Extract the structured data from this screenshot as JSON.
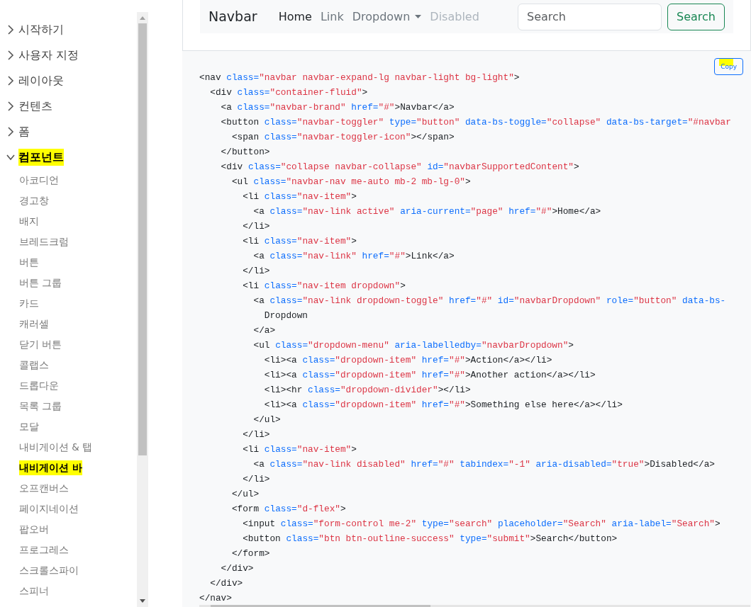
{
  "sidebar": {
    "sections": [
      {
        "label": "시작하기",
        "expanded": false,
        "highlighted": false
      },
      {
        "label": "사용자 지정",
        "expanded": false,
        "highlighted": false
      },
      {
        "label": "레이아웃",
        "expanded": false,
        "highlighted": false
      },
      {
        "label": "컨텐츠",
        "expanded": false,
        "highlighted": false
      },
      {
        "label": "폼",
        "expanded": false,
        "highlighted": false
      },
      {
        "label": "컴포넌트",
        "expanded": true,
        "highlighted": true,
        "children": [
          {
            "label": "아코디언",
            "selected": false,
            "highlighted": false
          },
          {
            "label": "경고창",
            "selected": false,
            "highlighted": false
          },
          {
            "label": "배지",
            "selected": false,
            "highlighted": false
          },
          {
            "label": "브레드크럼",
            "selected": false,
            "highlighted": false
          },
          {
            "label": "버튼",
            "selected": false,
            "highlighted": false
          },
          {
            "label": "버튼 그룹",
            "selected": false,
            "highlighted": false
          },
          {
            "label": "카드",
            "selected": false,
            "highlighted": false
          },
          {
            "label": "캐러셀",
            "selected": false,
            "highlighted": false
          },
          {
            "label": "닫기 버튼",
            "selected": false,
            "highlighted": false
          },
          {
            "label": "콜랩스",
            "selected": false,
            "highlighted": false
          },
          {
            "label": "드롭다운",
            "selected": false,
            "highlighted": false
          },
          {
            "label": "목록 그룹",
            "selected": false,
            "highlighted": false
          },
          {
            "label": "모달",
            "selected": false,
            "highlighted": false
          },
          {
            "label": "내비게이션 & 탭",
            "selected": false,
            "highlighted": false
          },
          {
            "label": "내비게이션 바",
            "selected": true,
            "highlighted": true
          },
          {
            "label": "오프캔버스",
            "selected": false,
            "highlighted": false
          },
          {
            "label": "페이지네이션",
            "selected": false,
            "highlighted": false
          },
          {
            "label": "팝오버",
            "selected": false,
            "highlighted": false
          },
          {
            "label": "프로그레스",
            "selected": false,
            "highlighted": false
          },
          {
            "label": "스크롤스파이",
            "selected": false,
            "highlighted": false
          },
          {
            "label": "스피너",
            "selected": false,
            "highlighted": false
          }
        ]
      }
    ]
  },
  "example": {
    "brand": "Navbar",
    "links": [
      {
        "label": "Home",
        "kind": "active"
      },
      {
        "label": "Link",
        "kind": "normal"
      },
      {
        "label": "Dropdown",
        "kind": "dropdown"
      },
      {
        "label": "Disabled",
        "kind": "disabled"
      }
    ],
    "search": {
      "placeholder": "Search"
    },
    "search_button": "Search"
  },
  "code": {
    "copy_button": {
      "label": "Copy",
      "highlighted": true
    },
    "lines": [
      [
        {
          "kind": "tag",
          "text": "<nav "
        },
        {
          "kind": "attr",
          "text": "class="
        },
        {
          "kind": "value",
          "text": "\"navbar navbar-expand-lg navbar-light bg-light\""
        },
        {
          "kind": "tag",
          "text": ">"
        }
      ],
      [
        {
          "kind": "tag",
          "text": "  <div "
        },
        {
          "kind": "attr",
          "text": "class="
        },
        {
          "kind": "value",
          "text": "\"container-fluid\""
        },
        {
          "kind": "tag",
          "text": ">"
        }
      ],
      [
        {
          "kind": "tag",
          "text": "    <a "
        },
        {
          "kind": "attr",
          "text": "class="
        },
        {
          "kind": "value",
          "text": "\"navbar-brand\" "
        },
        {
          "kind": "attr",
          "text": "href="
        },
        {
          "kind": "value",
          "text": "\"#\""
        },
        {
          "kind": "tag",
          "text": ">Navbar</a>"
        }
      ],
      [
        {
          "kind": "tag",
          "text": "    <button "
        },
        {
          "kind": "attr",
          "text": "class="
        },
        {
          "kind": "value",
          "text": "\"navbar-toggler\" "
        },
        {
          "kind": "attr",
          "text": "type="
        },
        {
          "kind": "value",
          "text": "\"button\" "
        },
        {
          "kind": "attr",
          "text": "data-bs-toggle="
        },
        {
          "kind": "value",
          "text": "\"collapse\" "
        },
        {
          "kind": "attr",
          "text": "data-bs-target="
        },
        {
          "kind": "value",
          "text": "\"#navbar"
        }
      ],
      [
        {
          "kind": "tag",
          "text": "      <span "
        },
        {
          "kind": "attr",
          "text": "class="
        },
        {
          "kind": "value",
          "text": "\"navbar-toggler-icon\""
        },
        {
          "kind": "tag",
          "text": "></span>"
        }
      ],
      [
        {
          "kind": "tag",
          "text": "    </button>"
        }
      ],
      [
        {
          "kind": "tag",
          "text": "    <div "
        },
        {
          "kind": "attr",
          "text": "class="
        },
        {
          "kind": "value",
          "text": "\"collapse navbar-collapse\" "
        },
        {
          "kind": "attr",
          "text": "id="
        },
        {
          "kind": "value",
          "text": "\"navbarSupportedContent\""
        },
        {
          "kind": "tag",
          "text": ">"
        }
      ],
      [
        {
          "kind": "tag",
          "text": "      <ul "
        },
        {
          "kind": "attr",
          "text": "class="
        },
        {
          "kind": "value",
          "text": "\"navbar-nav me-auto mb-2 mb-lg-0\""
        },
        {
          "kind": "tag",
          "text": ">"
        }
      ],
      [
        {
          "kind": "tag",
          "text": "        <li "
        },
        {
          "kind": "attr",
          "text": "class="
        },
        {
          "kind": "value",
          "text": "\"nav-item\""
        },
        {
          "kind": "tag",
          "text": ">"
        }
      ],
      [
        {
          "kind": "tag",
          "text": "          <a "
        },
        {
          "kind": "attr",
          "text": "class="
        },
        {
          "kind": "value",
          "text": "\"nav-link active\" "
        },
        {
          "kind": "attr",
          "text": "aria-current="
        },
        {
          "kind": "value",
          "text": "\"page\" "
        },
        {
          "kind": "attr",
          "text": "href="
        },
        {
          "kind": "value",
          "text": "\"#\""
        },
        {
          "kind": "tag",
          "text": ">Home</a>"
        }
      ],
      [
        {
          "kind": "tag",
          "text": "        </li>"
        }
      ],
      [
        {
          "kind": "tag",
          "text": "        <li "
        },
        {
          "kind": "attr",
          "text": "class="
        },
        {
          "kind": "value",
          "text": "\"nav-item\""
        },
        {
          "kind": "tag",
          "text": ">"
        }
      ],
      [
        {
          "kind": "tag",
          "text": "          <a "
        },
        {
          "kind": "attr",
          "text": "class="
        },
        {
          "kind": "value",
          "text": "\"nav-link\" "
        },
        {
          "kind": "attr",
          "text": "href="
        },
        {
          "kind": "value",
          "text": "\"#\""
        },
        {
          "kind": "tag",
          "text": ">Link</a>"
        }
      ],
      [
        {
          "kind": "tag",
          "text": "        </li>"
        }
      ],
      [
        {
          "kind": "tag",
          "text": "        <li "
        },
        {
          "kind": "attr",
          "text": "class="
        },
        {
          "kind": "value",
          "text": "\"nav-item dropdown\""
        },
        {
          "kind": "tag",
          "text": ">"
        }
      ],
      [
        {
          "kind": "tag",
          "text": "          <a "
        },
        {
          "kind": "attr",
          "text": "class="
        },
        {
          "kind": "value",
          "text": "\"nav-link dropdown-toggle\" "
        },
        {
          "kind": "attr",
          "text": "href="
        },
        {
          "kind": "value",
          "text": "\"#\" "
        },
        {
          "kind": "attr",
          "text": "id="
        },
        {
          "kind": "value",
          "text": "\"navbarDropdown\" "
        },
        {
          "kind": "attr",
          "text": "role="
        },
        {
          "kind": "value",
          "text": "\"button\" "
        },
        {
          "kind": "attr",
          "text": "data-bs-"
        }
      ],
      [
        {
          "kind": "tag",
          "text": "            Dropdown"
        }
      ],
      [
        {
          "kind": "tag",
          "text": "          </a>"
        }
      ],
      [
        {
          "kind": "tag",
          "text": "          <ul "
        },
        {
          "kind": "attr",
          "text": "class="
        },
        {
          "kind": "value",
          "text": "\"dropdown-menu\" "
        },
        {
          "kind": "attr",
          "text": "aria-labelledby="
        },
        {
          "kind": "value",
          "text": "\"navbarDropdown\""
        },
        {
          "kind": "tag",
          "text": ">"
        }
      ],
      [
        {
          "kind": "tag",
          "text": "            <li><a "
        },
        {
          "kind": "attr",
          "text": "class="
        },
        {
          "kind": "value",
          "text": "\"dropdown-item\" "
        },
        {
          "kind": "attr",
          "text": "href="
        },
        {
          "kind": "value",
          "text": "\"#\""
        },
        {
          "kind": "tag",
          "text": ">Action</a></li>"
        }
      ],
      [
        {
          "kind": "tag",
          "text": "            <li><a "
        },
        {
          "kind": "attr",
          "text": "class="
        },
        {
          "kind": "value",
          "text": "\"dropdown-item\" "
        },
        {
          "kind": "attr",
          "text": "href="
        },
        {
          "kind": "value",
          "text": "\"#\""
        },
        {
          "kind": "tag",
          "text": ">Another action</a></li>"
        }
      ],
      [
        {
          "kind": "tag",
          "text": "            <li><hr "
        },
        {
          "kind": "attr",
          "text": "class="
        },
        {
          "kind": "value",
          "text": "\"dropdown-divider\""
        },
        {
          "kind": "tag",
          "text": "></li>"
        }
      ],
      [
        {
          "kind": "tag",
          "text": "            <li><a "
        },
        {
          "kind": "attr",
          "text": "class="
        },
        {
          "kind": "value",
          "text": "\"dropdown-item\" "
        },
        {
          "kind": "attr",
          "text": "href="
        },
        {
          "kind": "value",
          "text": "\"#\""
        },
        {
          "kind": "tag",
          "text": ">Something else here</a></li>"
        }
      ],
      [
        {
          "kind": "tag",
          "text": "          </ul>"
        }
      ],
      [
        {
          "kind": "tag",
          "text": "        </li>"
        }
      ],
      [
        {
          "kind": "tag",
          "text": "        <li "
        },
        {
          "kind": "attr",
          "text": "class="
        },
        {
          "kind": "value",
          "text": "\"nav-item\""
        },
        {
          "kind": "tag",
          "text": ">"
        }
      ],
      [
        {
          "kind": "tag",
          "text": "          <a "
        },
        {
          "kind": "attr",
          "text": "class="
        },
        {
          "kind": "value",
          "text": "\"nav-link disabled\" "
        },
        {
          "kind": "attr",
          "text": "href="
        },
        {
          "kind": "value",
          "text": "\"#\" "
        },
        {
          "kind": "attr",
          "text": "tabindex="
        },
        {
          "kind": "value",
          "text": "\"-1\" "
        },
        {
          "kind": "attr",
          "text": "aria-disabled="
        },
        {
          "kind": "value",
          "text": "\"true\""
        },
        {
          "kind": "tag",
          "text": ">Disabled</a>"
        }
      ],
      [
        {
          "kind": "tag",
          "text": "        </li>"
        }
      ],
      [
        {
          "kind": "tag",
          "text": "      </ul>"
        }
      ],
      [
        {
          "kind": "tag",
          "text": "      <form "
        },
        {
          "kind": "attr",
          "text": "class="
        },
        {
          "kind": "value",
          "text": "\"d-flex\""
        },
        {
          "kind": "tag",
          "text": ">"
        }
      ],
      [
        {
          "kind": "tag",
          "text": "        <input "
        },
        {
          "kind": "attr",
          "text": "class="
        },
        {
          "kind": "value",
          "text": "\"form-control me-2\" "
        },
        {
          "kind": "attr",
          "text": "type="
        },
        {
          "kind": "value",
          "text": "\"search\" "
        },
        {
          "kind": "attr",
          "text": "placeholder="
        },
        {
          "kind": "value",
          "text": "\"Search\" "
        },
        {
          "kind": "attr",
          "text": "aria-label="
        },
        {
          "kind": "value",
          "text": "\"Search\""
        },
        {
          "kind": "tag",
          "text": ">"
        }
      ],
      [
        {
          "kind": "tag",
          "text": "        <button "
        },
        {
          "kind": "attr",
          "text": "class="
        },
        {
          "kind": "value",
          "text": "\"btn btn-outline-success\" "
        },
        {
          "kind": "attr",
          "text": "type="
        },
        {
          "kind": "value",
          "text": "\"submit\""
        },
        {
          "kind": "tag",
          "text": ">Search</button>"
        }
      ],
      [
        {
          "kind": "tag",
          "text": "      </form>"
        }
      ],
      [
        {
          "kind": "tag",
          "text": "    </div>"
        }
      ],
      [
        {
          "kind": "tag",
          "text": "  </div>"
        }
      ],
      [
        {
          "kind": "tag",
          "text": "</nav>"
        }
      ]
    ]
  }
}
